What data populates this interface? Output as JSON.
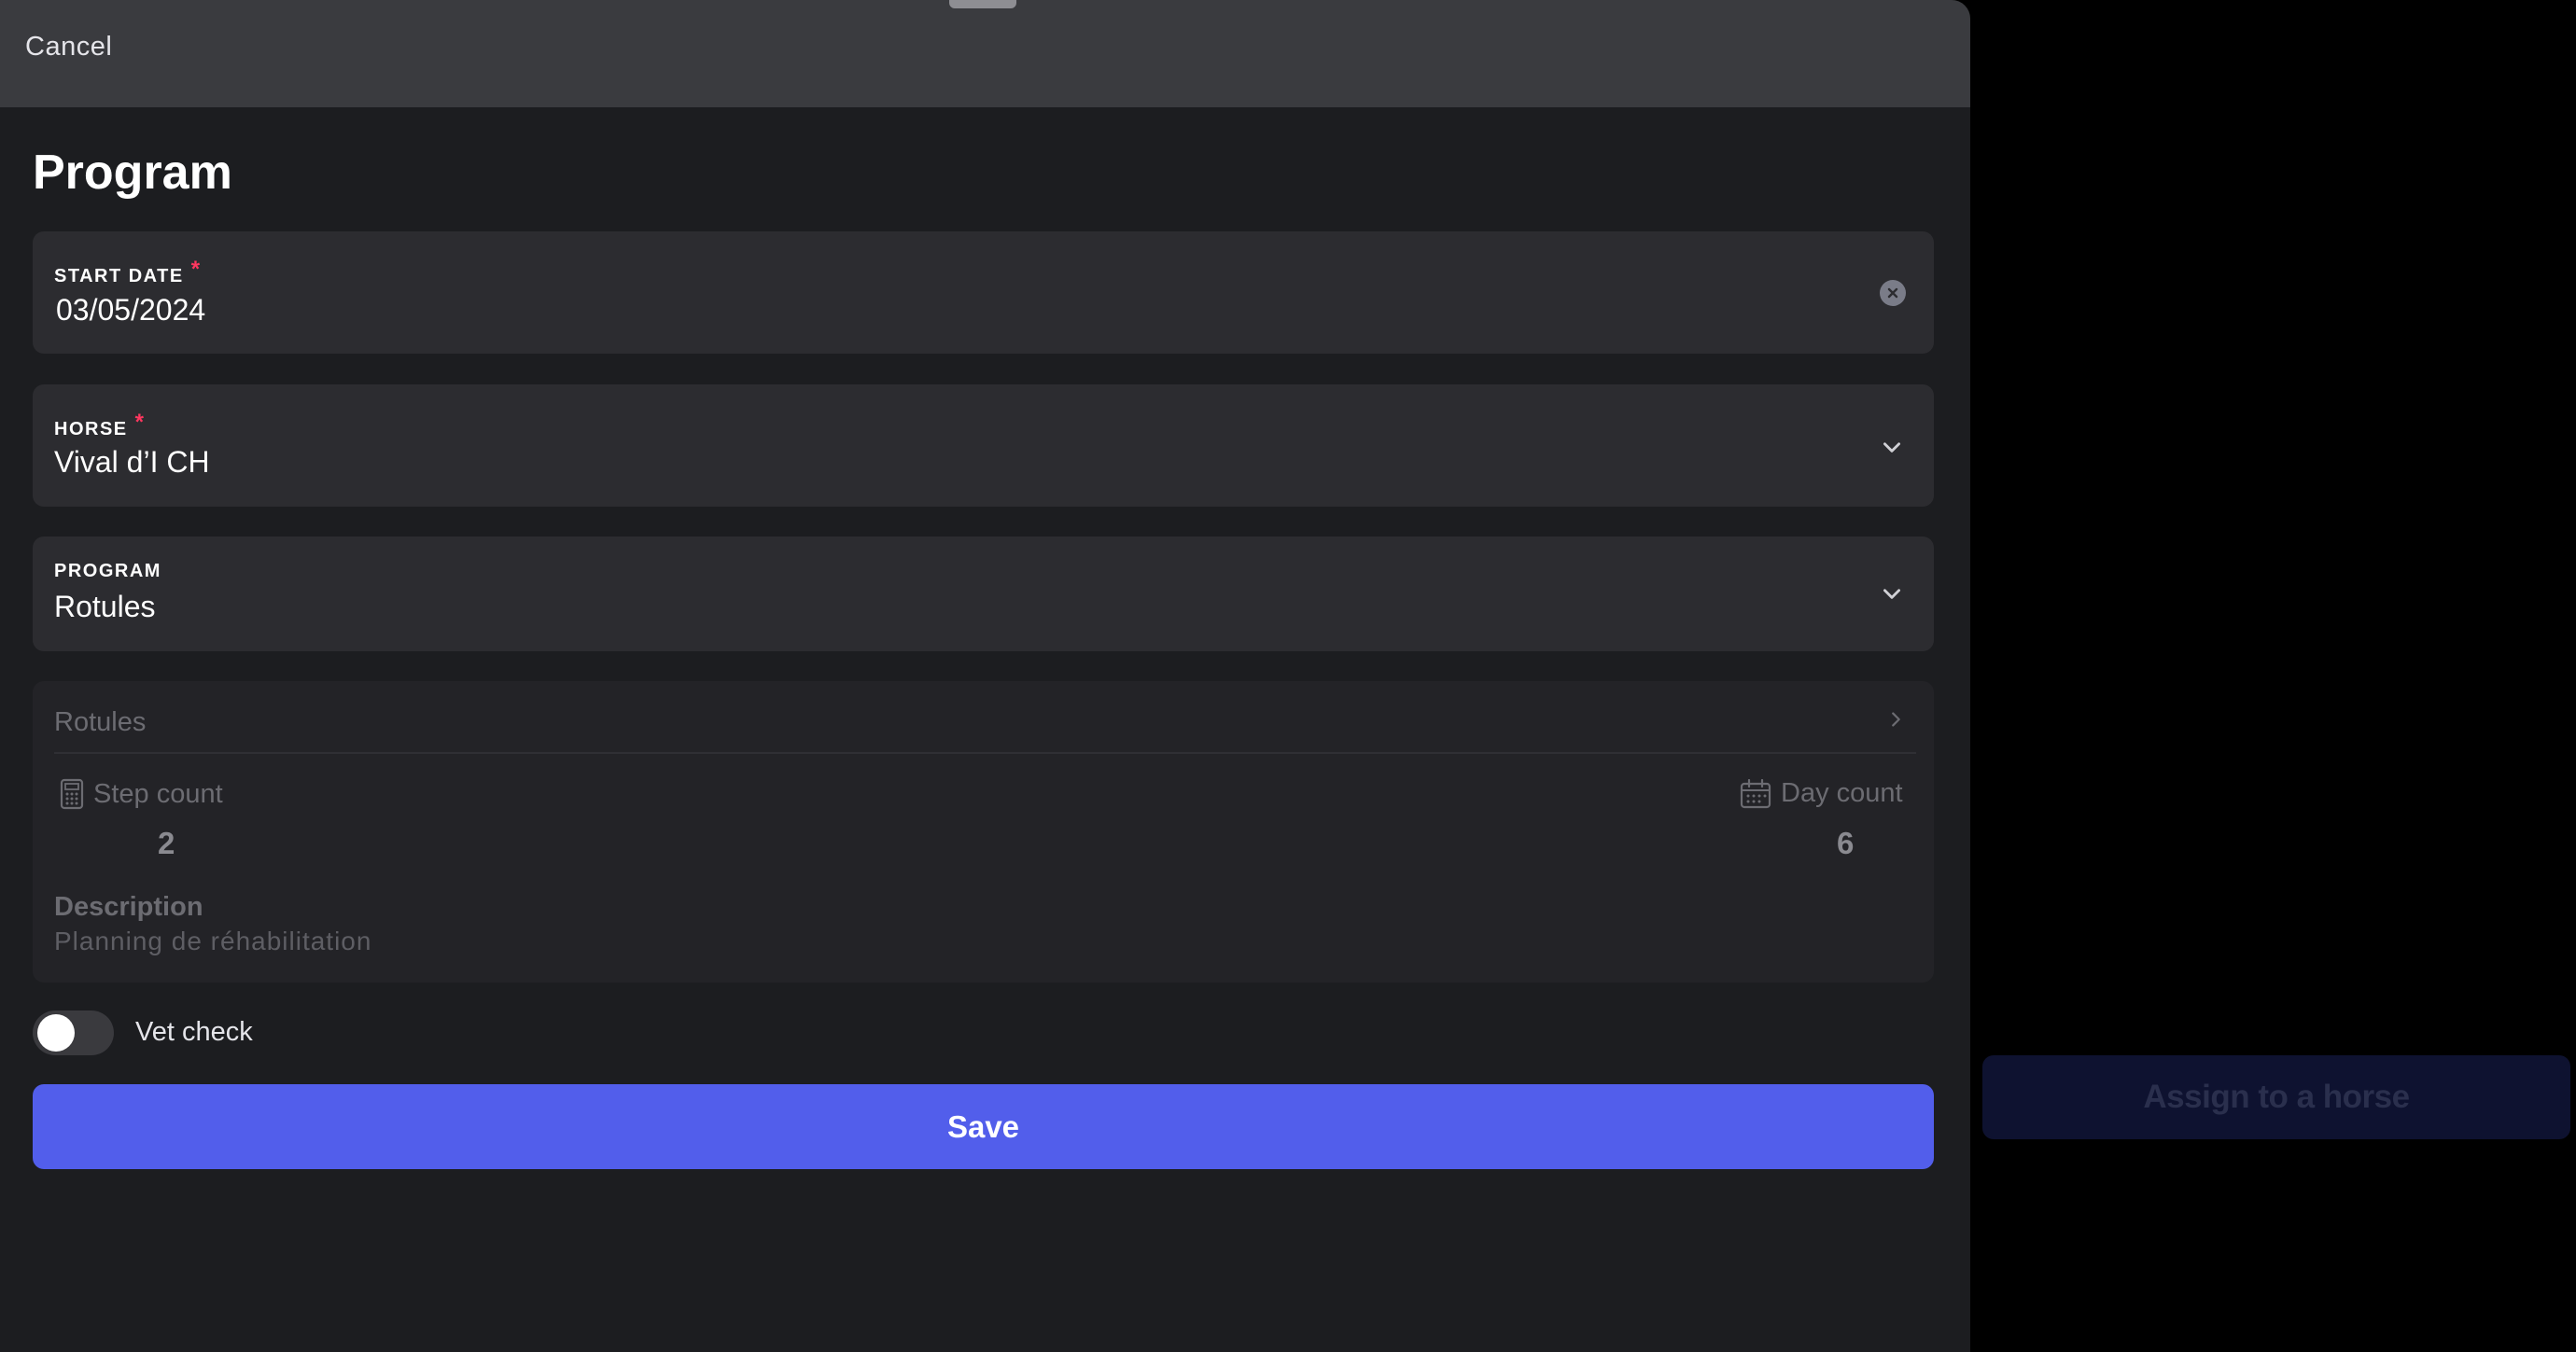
{
  "background": {
    "assign_button_label": "Assign to a horse"
  },
  "header": {
    "cancel_label": "Cancel"
  },
  "title": "Program",
  "fields": {
    "start_date": {
      "label": "START DATE",
      "required_mark": "*",
      "value": "03/05/2024",
      "clear_icon": "clear-circle-icon"
    },
    "horse": {
      "label": "HORSE",
      "required_mark": "*",
      "value": "Vival d’I CH",
      "icon": "chevron-down-icon"
    },
    "program": {
      "label": "PROGRAM",
      "value": "Rotules",
      "icon": "chevron-down-icon"
    }
  },
  "program_info": {
    "name": "Rotules",
    "step_count_label": "Step count",
    "step_count_value": "2",
    "day_count_label": "Day count",
    "day_count_value": "6",
    "description_label": "Description",
    "description_value": "Planning de réhabilitation"
  },
  "vet_check": {
    "label": "Vet check",
    "enabled": false
  },
  "save_label": "Save",
  "colors": {
    "accent": "#525eeb",
    "required": "#ff375f",
    "sheet_bg": "#1c1d20",
    "field_bg": "#2c2c30"
  }
}
